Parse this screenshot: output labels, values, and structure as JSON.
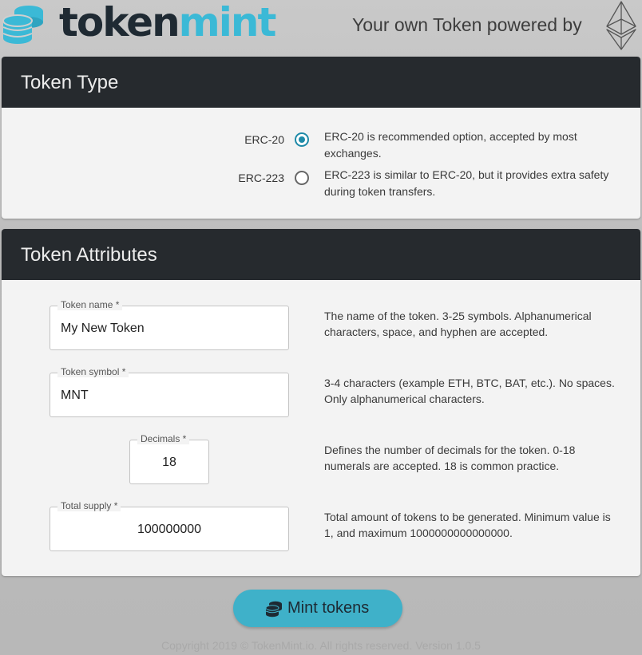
{
  "header": {
    "logo_part1": "token",
    "logo_part2": "mint",
    "tagline": "Your own Token powered by",
    "logo_icon": "coin-stack-icon",
    "platform_icon": "ethereum-icon"
  },
  "token_type": {
    "title": "Token Type",
    "options": [
      {
        "label": "ERC-20",
        "checked": true,
        "description": "ERC-20 is recommended option, accepted by most exchanges."
      },
      {
        "label": "ERC-223",
        "checked": false,
        "description": "ERC-223 is similar to ERC-20, but it provides extra safety during token transfers."
      }
    ]
  },
  "token_attributes": {
    "title": "Token Attributes",
    "fields": {
      "name": {
        "label": "Token name *",
        "value": "My New Token",
        "description": "The name of the token. 3-25 symbols. Alphanumerical characters, space, and hyphen are accepted."
      },
      "symbol": {
        "label": "Token symbol *",
        "value": "MNT",
        "description": "3-4 characters (example ETH, BTC, BAT, etc.). No spaces. Only alphanumerical characters."
      },
      "decimals": {
        "label": "Decimals *",
        "value": "18",
        "description": "Defines the number of decimals for the token. 0-18 numerals are accepted. 18 is common practice."
      },
      "supply": {
        "label": "Total supply *",
        "value": "100000000",
        "description": "Total amount of tokens to be generated. Minimum value is 1, and maximum 1000000000000000."
      }
    }
  },
  "mint_button": {
    "label": "Mint tokens",
    "icon": "coins-icon"
  },
  "footer": {
    "text": "Copyright 2019 © TokenMint.io. All rights reserved. Version 1.0.5"
  },
  "colors": {
    "accent": "#3fb1c9",
    "radio": "#1e8aa8",
    "header_bar": "#262a2e",
    "logo_dark": "#1f2a33",
    "logo_light": "#3bb9d6"
  }
}
